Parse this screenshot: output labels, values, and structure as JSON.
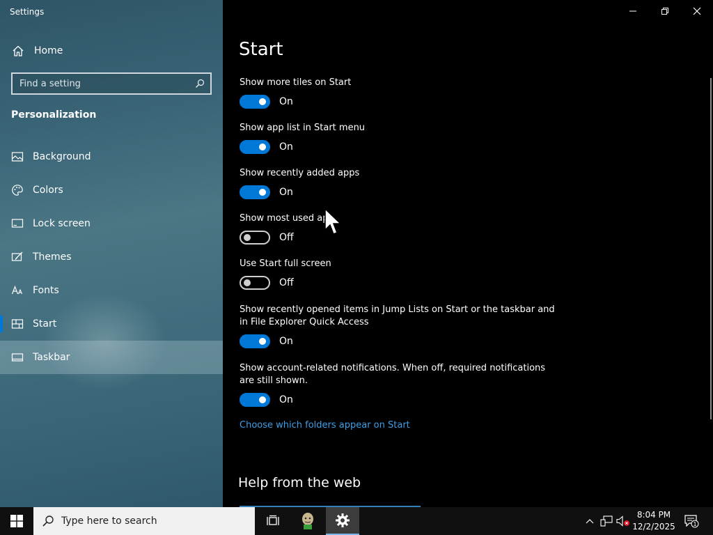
{
  "window": {
    "title": "Settings"
  },
  "sidebar": {
    "home_label": "Home",
    "search_placeholder": "Find a setting",
    "section": "Personalization",
    "items": [
      {
        "label": "Background"
      },
      {
        "label": "Colors"
      },
      {
        "label": "Lock screen"
      },
      {
        "label": "Themes"
      },
      {
        "label": "Fonts"
      },
      {
        "label": "Start"
      },
      {
        "label": "Taskbar"
      }
    ]
  },
  "main": {
    "title": "Start",
    "settings": [
      {
        "label": "Show more tiles on Start",
        "state": "On"
      },
      {
        "label": "Show app list in Start menu",
        "state": "On"
      },
      {
        "label": "Show recently added apps",
        "state": "On"
      },
      {
        "label": "Show most used ap",
        "state": "Off"
      },
      {
        "label": "Use Start full screen",
        "state": "Off"
      },
      {
        "label": "Show recently opened items in Jump Lists on Start or the taskbar and in File Explorer Quick Access",
        "state": "On"
      },
      {
        "label": "Show account-related notifications. When off, required notifications are still shown.",
        "state": "On"
      }
    ],
    "folders_link": "Choose which folders appear on Start",
    "help_heading": "Help from the web"
  },
  "taskbar": {
    "search_placeholder": "Type here to search",
    "time": "8:04 PM",
    "date": "12/2/2025",
    "notification_count": "1"
  },
  "colors": {
    "accent": "#0078d7",
    "link": "#3f9fe8"
  }
}
